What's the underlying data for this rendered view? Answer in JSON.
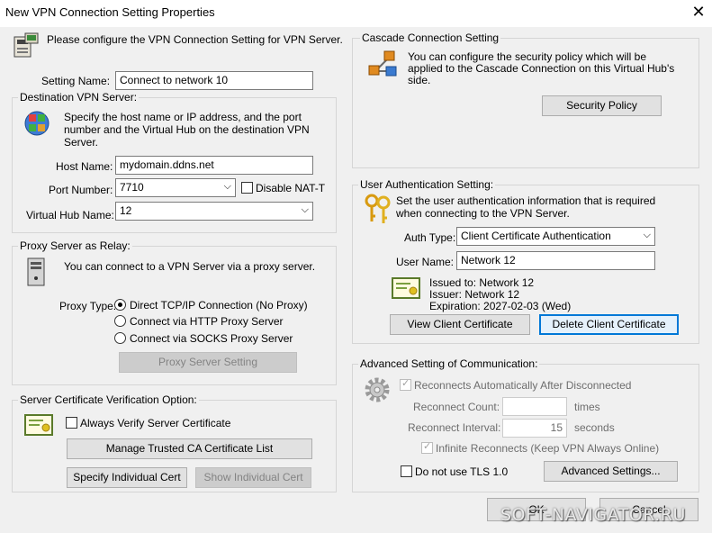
{
  "window": {
    "title": "New VPN Connection Setting Properties",
    "close_glyph": "✕"
  },
  "intro_text": "Please configure the VPN Connection Setting for VPN Server.",
  "setting_name": {
    "label": "Setting Name:",
    "value": "Connect to network 10"
  },
  "destination": {
    "group_label": "Destination VPN Server:",
    "description": "Specify the host name or IP address, and the port number and the Virtual Hub on the destination VPN Server.",
    "host_label": "Host Name:",
    "host_value": "mydomain.ddns.net",
    "port_label": "Port Number:",
    "port_value": "7710",
    "disable_nat_label": "Disable NAT-T",
    "hub_label": "Virtual Hub Name:",
    "hub_value": "12"
  },
  "proxy": {
    "group_label": "Proxy Server as Relay:",
    "description": "You can connect to a VPN Server via a proxy server.",
    "type_label": "Proxy Type:",
    "options": [
      "Direct TCP/IP Connection (No Proxy)",
      "Connect via HTTP Proxy Server",
      "Connect via SOCKS Proxy Server"
    ],
    "selected": "Direct TCP/IP Connection (No Proxy)",
    "setting_button": "Proxy Server Setting"
  },
  "server_cert": {
    "group_label": "Server Certificate Verification Option:",
    "always_verify_label": "Always Verify Server Certificate",
    "manage_ca_button": "Manage Trusted CA Certificate List",
    "specify_cert_button": "Specify Individual Cert",
    "show_cert_button": "Show Individual Cert"
  },
  "cascade": {
    "group_label": "Cascade Connection Setting",
    "description": "You can configure the security policy which will be applied to the Cascade Connection on this Virtual Hub's side.",
    "policy_button": "Security Policy"
  },
  "auth": {
    "group_label": "User Authentication Setting:",
    "description": "Set the user authentication information that is required when connecting to the VPN Server.",
    "type_label": "Auth Type:",
    "type_value": "Client Certificate Authentication",
    "user_label": "User Name:",
    "user_value": "Network 12",
    "issued_to": "Issued to: Network 12",
    "issuer": "Issuer: Network 12",
    "expiration": "Expiration: 2027-02-03 (Wed)",
    "view_button": "View Client Certificate",
    "delete_button": "Delete Client Certificate"
  },
  "advanced": {
    "group_label": "Advanced Setting of Communication:",
    "reconnect_label": "Reconnects Automatically After Disconnected",
    "count_label": "Reconnect Count:",
    "count_value": "",
    "count_unit": "times",
    "interval_label": "Reconnect Interval:",
    "interval_value": "15",
    "interval_unit": "seconds",
    "infinite_label": "Infinite Reconnects (Keep VPN Always Online)",
    "no_tls_label": "Do not use TLS 1.0",
    "settings_button": "Advanced Settings..."
  },
  "footer": {
    "ok": "OK",
    "cancel": "Cancel"
  },
  "watermark": "SOFT-NAVIGATOR.RU"
}
